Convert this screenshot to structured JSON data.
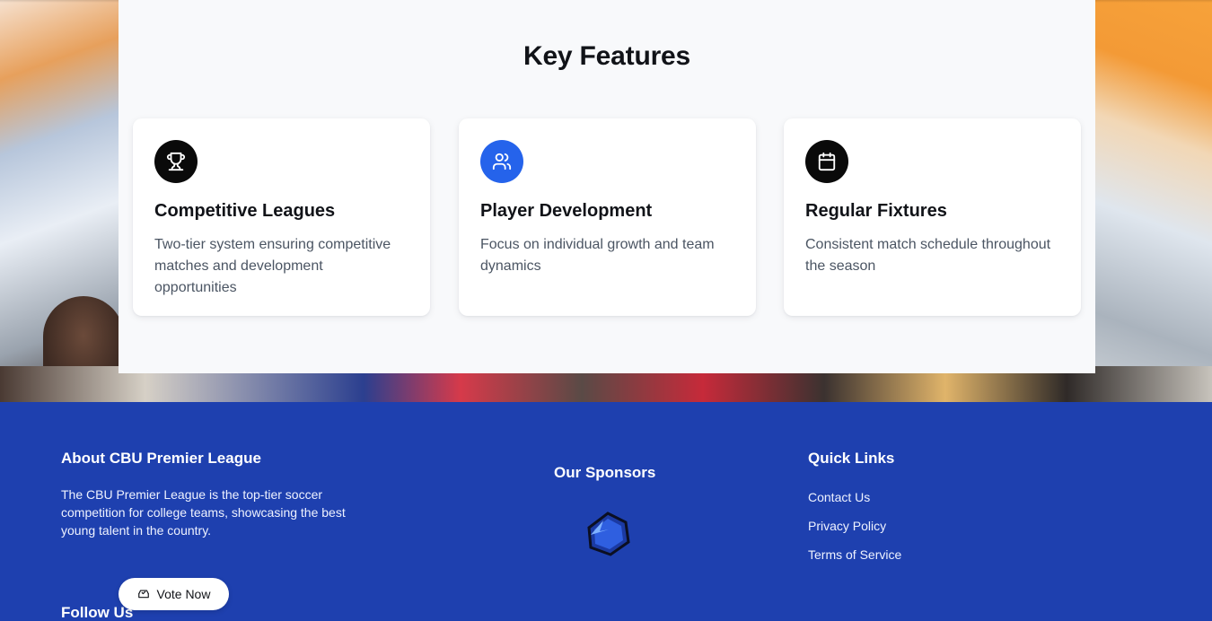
{
  "features": {
    "title": "Key Features",
    "cards": [
      {
        "icon": "trophy-icon",
        "title": "Competitive Leagues",
        "description": "Two-tier system ensuring competitive matches and development opportunities"
      },
      {
        "icon": "users-icon",
        "title": "Player Development",
        "description": "Focus on individual growth and team dynamics"
      },
      {
        "icon": "calendar-icon",
        "title": "Regular Fixtures",
        "description": "Consistent match schedule throughout the season"
      }
    ]
  },
  "footer": {
    "about_title": "About CBU Premier League",
    "about_text": "The CBU Premier League is the top-tier soccer competition for college teams, showcasing the best young talent in the country.",
    "follow_title": "Follow Us",
    "sponsors_title": "Our Sponsors",
    "quick_links_title": "Quick Links",
    "quick_links": [
      "Contact Us",
      "Privacy Policy",
      "Terms of Service"
    ]
  },
  "vote_button": {
    "label": "Vote Now",
    "icon": "ballot-box-icon"
  },
  "colors": {
    "footer_bg": "#1e40af",
    "accent_blue": "#2563eb",
    "icon_dark": "#0a0a0a"
  }
}
